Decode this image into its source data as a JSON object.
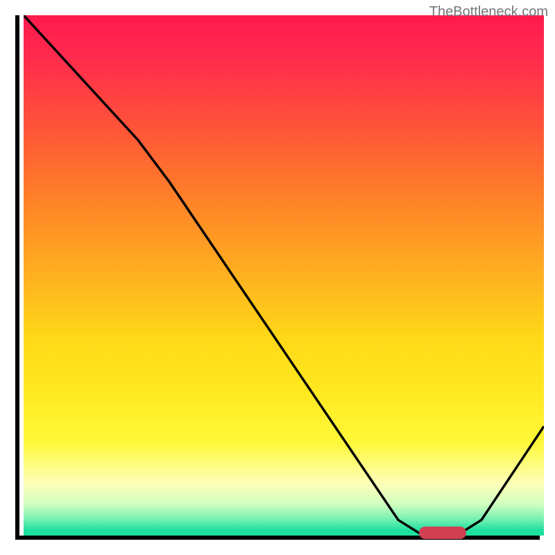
{
  "watermark": "TheBottleneck.com",
  "chart_data": {
    "type": "line",
    "title": "",
    "xlabel": "",
    "ylabel": "",
    "x_range": [
      0,
      100
    ],
    "y_range": [
      0,
      100
    ],
    "curve_points": [
      {
        "x": 0,
        "y": 100
      },
      {
        "x": 22,
        "y": 76
      },
      {
        "x": 28,
        "y": 68
      },
      {
        "x": 72,
        "y": 3
      },
      {
        "x": 76,
        "y": 0.5
      },
      {
        "x": 84,
        "y": 0.5
      },
      {
        "x": 88,
        "y": 3
      },
      {
        "x": 100,
        "y": 21
      }
    ],
    "marker": {
      "x_start": 76,
      "x_end": 85,
      "y": 0.5,
      "color": "#d04050"
    },
    "gradient_colors": {
      "top": "#ff1a4d",
      "middle": "#ffe820",
      "bottom": "#1de0a0"
    }
  }
}
